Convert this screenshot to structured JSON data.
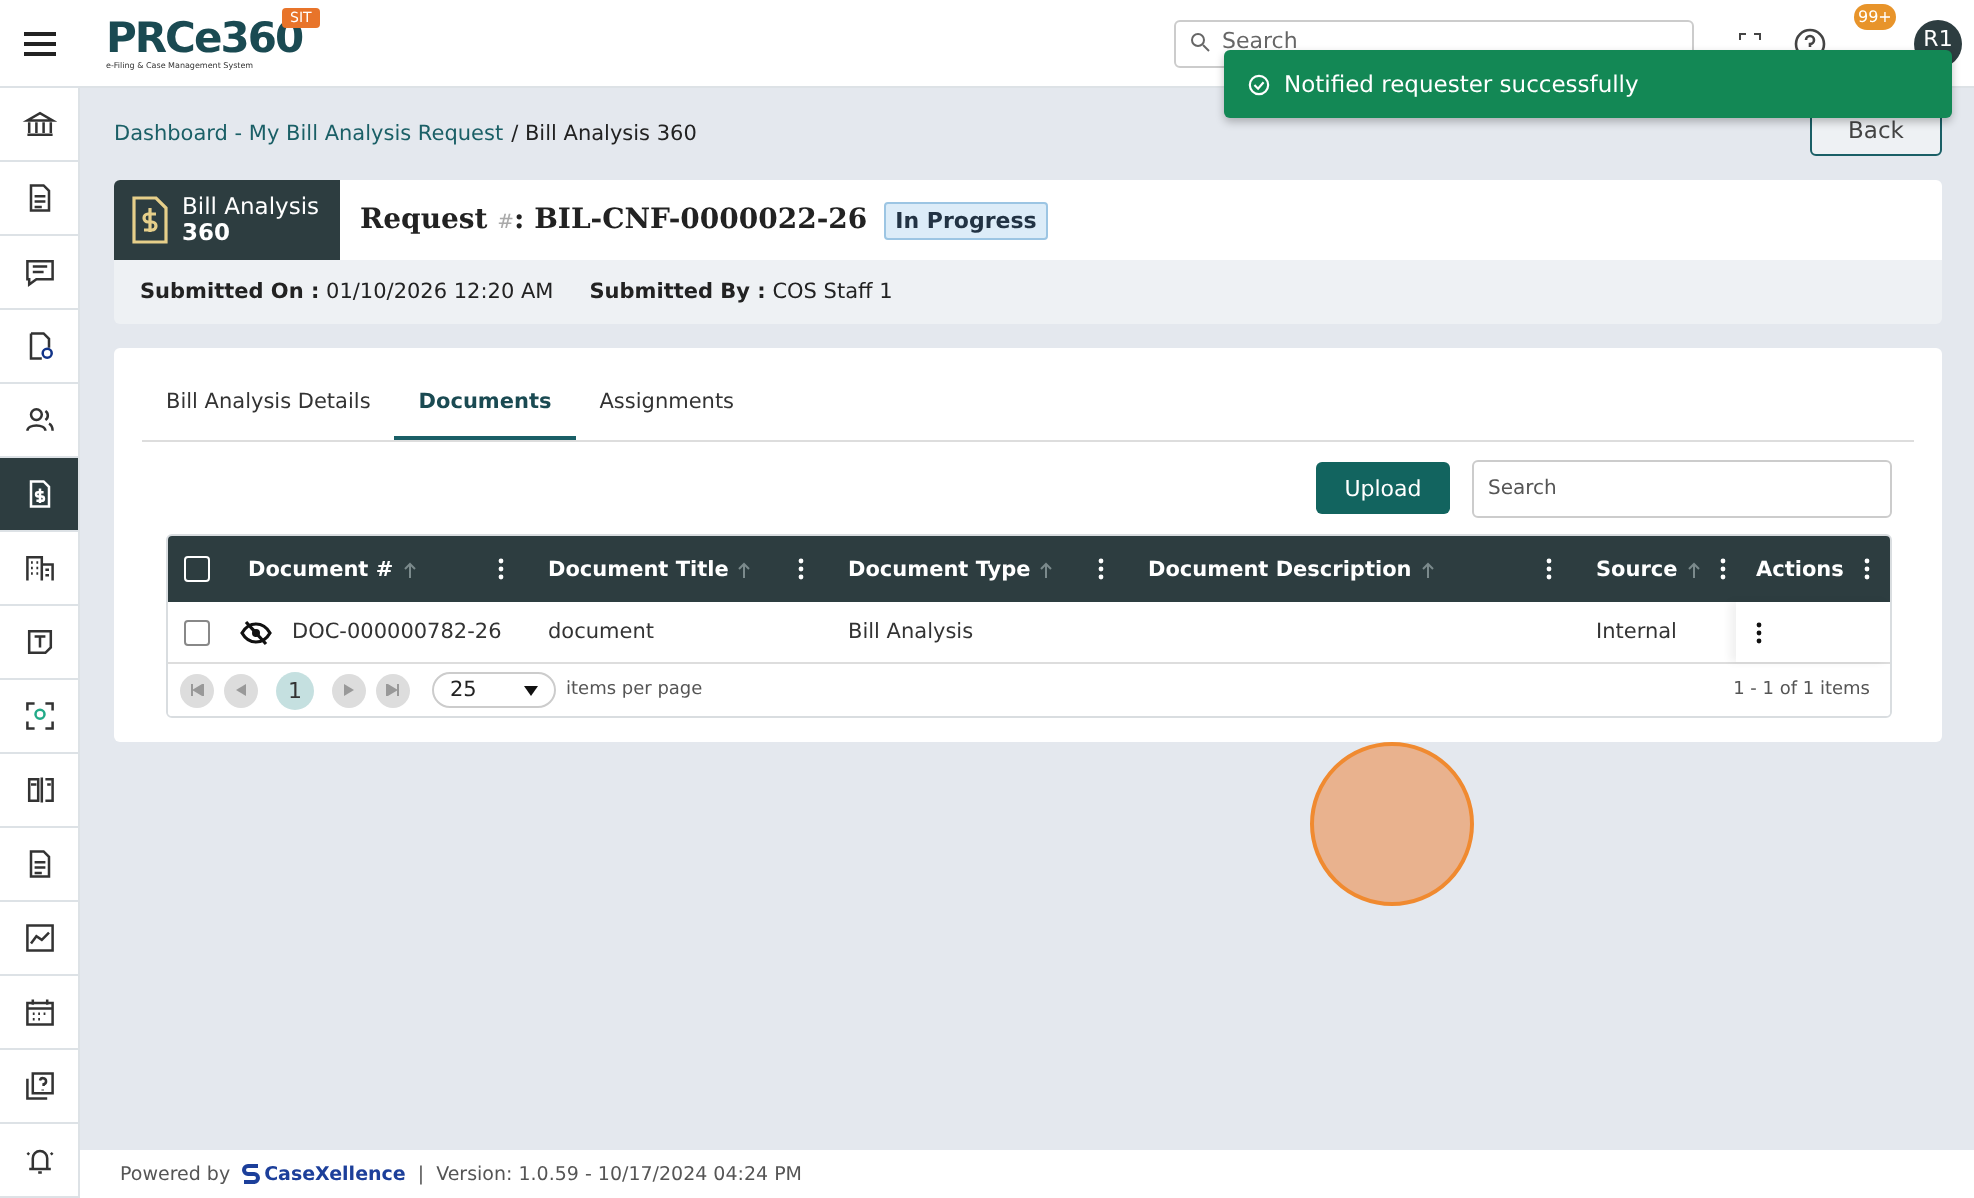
{
  "header": {
    "logo": "PRCe360",
    "logo_subtitle": "e-Filing & Case Management System",
    "env_badge": "SIT",
    "search": {
      "placeholder": "Search"
    },
    "notification_count": "99+",
    "avatar": "R1"
  },
  "toast": {
    "message": "Notified requester successfully"
  },
  "sidebar": {
    "items": [
      {
        "selected": false
      },
      {
        "selected": false
      },
      {
        "selected": false
      },
      {
        "selected": false
      },
      {
        "selected": false
      },
      {
        "selected": true
      },
      {
        "selected": false
      },
      {
        "selected": false
      },
      {
        "selected": false
      },
      {
        "selected": false
      },
      {
        "selected": false
      },
      {
        "selected": false
      },
      {
        "selected": false
      },
      {
        "selected": false
      },
      {
        "selected": false
      }
    ]
  },
  "breadcrumb": {
    "link": "Dashboard - My Bill Analysis Request",
    "current": "/ Bill Analysis 360"
  },
  "back_button": "Back",
  "request": {
    "module_line1": "Bill Analysis",
    "module_line2": "360",
    "title_prefix": "Request ",
    "title_mark": "#",
    "title_rest": ": BIL-CNF-0000022-26",
    "status": "In Progress",
    "submitted_on_label": "Submitted On :",
    "submitted_on": "01/10/2026 12:20 AM",
    "submitted_by_label": "Submitted By :",
    "submitted_by": "COS Staff 1"
  },
  "tabs": [
    {
      "label": "Bill Analysis Details",
      "selected": false
    },
    {
      "label": "Documents",
      "selected": true
    },
    {
      "label": "Assignments",
      "selected": false
    }
  ],
  "upload_button": "Upload",
  "table_search": {
    "placeholder": "Search"
  },
  "table": {
    "select_all": {
      "checked": false
    },
    "columns": [
      {
        "label": "Document #",
        "sortable": true
      },
      {
        "label": "Document Title",
        "sortable": true
      },
      {
        "label": "Document Type",
        "sortable": true
      },
      {
        "label": "Document Description",
        "sortable": true
      },
      {
        "label": "Source",
        "sortable": true
      },
      {
        "label": "Actions",
        "sortable": false
      }
    ],
    "rows": [
      {
        "checked": false,
        "hidden": true,
        "cells": [
          "DOC-000000782-26",
          "document",
          "Bill Analysis",
          "",
          "Internal"
        ]
      }
    ]
  },
  "pager": {
    "current_page": "1",
    "page_size": "25",
    "page_size_label": "items per page",
    "summary": "1 - 1 of 1 items"
  },
  "footer": {
    "powered_by": "Powered by",
    "brand": "CaseXellence",
    "separator": "|",
    "version": "Version: 1.0.59 - 10/17/2024 04:24 PM"
  }
}
